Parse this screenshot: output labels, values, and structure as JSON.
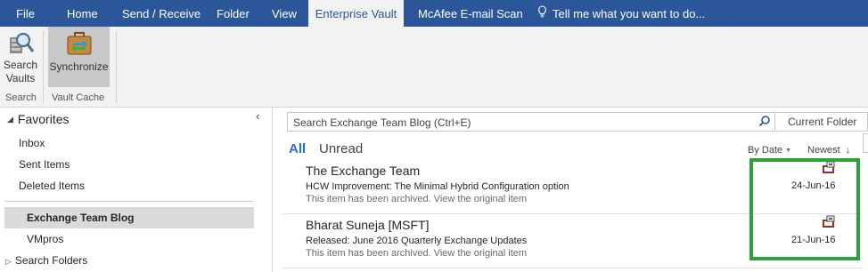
{
  "tabs": [
    "File",
    "Home",
    "Send / Receive",
    "Folder",
    "View",
    "Enterprise Vault",
    "McAfee E-mail Scan",
    "Tell me what you want to do..."
  ],
  "ribbon": {
    "search_vaults_line1": "Search",
    "search_vaults_line2": "Vaults",
    "search_group": "Search",
    "synchronize": "Synchronize",
    "vault_cache_group": "Vault Cache"
  },
  "folders": {
    "favorites": "Favorites",
    "items": [
      "Inbox",
      "Sent Items",
      "Deleted Items"
    ],
    "selected": "Exchange Team Blog",
    "vmpros": "VMpros",
    "search_folders": "Search Folders"
  },
  "search": {
    "placeholder": "Search Exchange Team Blog (Ctrl+E)",
    "scope": "Current Folder"
  },
  "filters": {
    "all": "All",
    "unread": "Unread"
  },
  "sort": {
    "by": "By Date",
    "order": "Newest",
    "order_arrow": "↓"
  },
  "messages": [
    {
      "from": "The Exchange Team",
      "subject": "HCW Improvement: The Minimal Hybrid Configuration option",
      "preview": "This item has been archived. View the original item",
      "date": "24-Jun-16"
    },
    {
      "from": "Bharat Suneja [MSFT]",
      "subject": "Released:  June 2016 Quarterly Exchange Updates",
      "preview": "This item has been archived. View the original item",
      "date": "21-Jun-16"
    }
  ],
  "colors": {
    "titlebar": "#2b579a",
    "accent_blue": "#2b6fbf",
    "highlight_green": "#2aa43a"
  }
}
